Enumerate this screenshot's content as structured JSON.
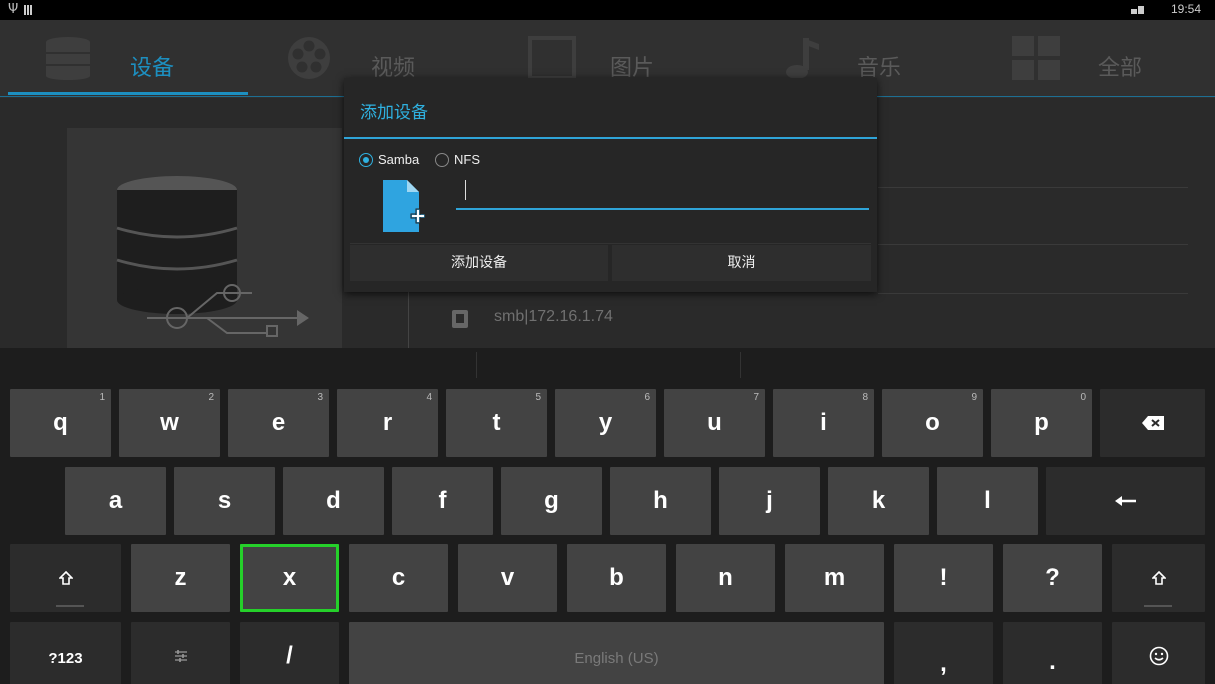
{
  "status_bar": {
    "usb_icon": "usb-icon",
    "sd_icon": "sdcard-icon",
    "network_icon": "network-icon",
    "time": "19:54"
  },
  "tabs": [
    {
      "label": "设备",
      "icon": "database-icon",
      "active": true
    },
    {
      "label": "视频",
      "icon": "film-reel-icon",
      "active": false
    },
    {
      "label": "图片",
      "icon": "picture-frame-icon",
      "active": false
    },
    {
      "label": "音乐",
      "icon": "music-note-icon",
      "active": false
    },
    {
      "label": "全部",
      "icon": "grid-icon",
      "active": false
    }
  ],
  "device_list": {
    "item": "smb|172.16.1.74",
    "item_icon": "network-share-icon"
  },
  "dialog": {
    "title": "添加设备",
    "protocols": [
      {
        "label": "Samba",
        "checked": true
      },
      {
        "label": "NFS",
        "checked": false
      }
    ],
    "input_value": "",
    "add_button": "添加设备",
    "cancel_button": "取消",
    "accent_color": "#2fb1e0"
  },
  "keyboard": {
    "rows": [
      [
        {
          "label": "q",
          "hint": "1"
        },
        {
          "label": "w",
          "hint": "2"
        },
        {
          "label": "e",
          "hint": "3"
        },
        {
          "label": "r",
          "hint": "4"
        },
        {
          "label": "t",
          "hint": "5"
        },
        {
          "label": "y",
          "hint": "6"
        },
        {
          "label": "u",
          "hint": "7"
        },
        {
          "label": "i",
          "hint": "8"
        },
        {
          "label": "o",
          "hint": "9"
        },
        {
          "label": "p",
          "hint": "0"
        },
        {
          "label": "",
          "icon": "backspace-icon"
        }
      ],
      [
        {
          "label": "a"
        },
        {
          "label": "s"
        },
        {
          "label": "d"
        },
        {
          "label": "f"
        },
        {
          "label": "g"
        },
        {
          "label": "h"
        },
        {
          "label": "j"
        },
        {
          "label": "k"
        },
        {
          "label": "l"
        },
        {
          "label": "",
          "icon": "enter-icon"
        }
      ],
      [
        {
          "label": "",
          "icon": "shift-icon"
        },
        {
          "label": "z"
        },
        {
          "label": "x"
        },
        {
          "label": "c"
        },
        {
          "label": "v"
        },
        {
          "label": "b"
        },
        {
          "label": "n"
        },
        {
          "label": "m"
        },
        {
          "label": "!"
        },
        {
          "label": "?"
        },
        {
          "label": "",
          "icon": "shift-icon"
        }
      ],
      [
        {
          "label": "?123"
        },
        {
          "label": "",
          "icon": "settings-sliders-icon"
        },
        {
          "label": "/"
        },
        {
          "label": "English (US)"
        },
        {
          "label": ","
        },
        {
          "label": "."
        },
        {
          "label": "",
          "icon": "emoji-icon"
        }
      ]
    ],
    "highlighted_key": "x",
    "highlight_color": "#25d02a"
  }
}
